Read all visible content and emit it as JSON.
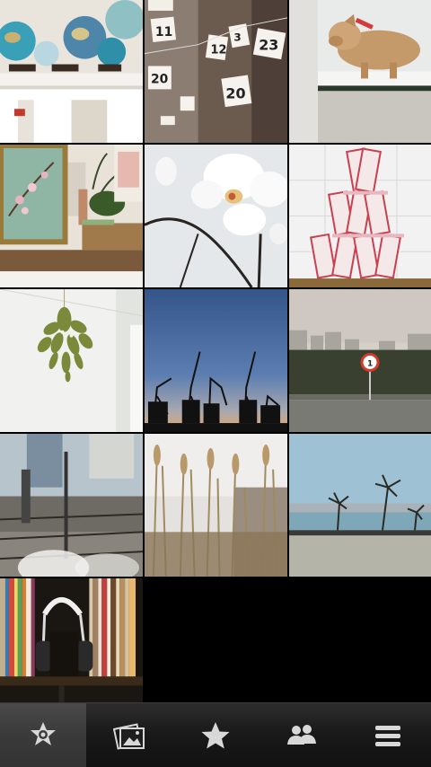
{
  "app": {
    "name": "photo-gallery"
  },
  "photos": [
    {
      "subject": "globes on shelf"
    },
    {
      "subject": "numbered paper tags"
    },
    {
      "subject": "straw pig toy"
    },
    {
      "subject": "blossom painting and vase"
    },
    {
      "subject": "white orchid"
    },
    {
      "subject": "house of cards"
    },
    {
      "subject": "hanging mistletoe"
    },
    {
      "subject": "harbor cranes at dusk"
    },
    {
      "subject": "road sign with apartment blocks"
    },
    {
      "subject": "blurred rail tracks"
    },
    {
      "subject": "dry reeds"
    },
    {
      "subject": "palm trees by water"
    },
    {
      "subject": "record shelf with headphones"
    }
  ],
  "tabbar": {
    "tabs": [
      {
        "id": "featured",
        "icon": "flower-star-icon",
        "active": true
      },
      {
        "id": "albums",
        "icon": "photo-album-icon",
        "active": false
      },
      {
        "id": "favorites",
        "icon": "star-icon",
        "active": false
      },
      {
        "id": "people",
        "icon": "people-icon",
        "active": false
      },
      {
        "id": "menu",
        "icon": "menu-lines-icon",
        "active": false
      }
    ]
  },
  "colors": {
    "tabbar_bg": "#1a1a1a",
    "active_tab_bg": "#3a3a3a",
    "icon": "#d8d8d8"
  }
}
